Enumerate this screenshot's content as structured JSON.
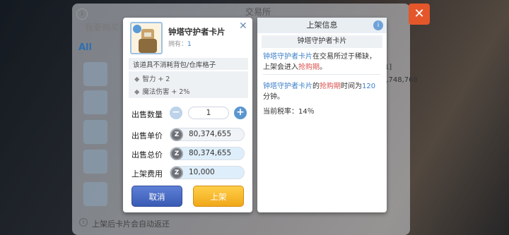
{
  "background": {
    "title": "交易所",
    "search_hint": "我要购买",
    "tab_all": "All",
    "number_visible": "1,748,768",
    "number_top": "[1]",
    "footer_text": "上架后卡片会自动返还",
    "close_label": "✕"
  },
  "left_panel": {
    "card_name": "钟塔守护者卡片",
    "owned_label": "拥有：",
    "owned_value": "1",
    "close_icon": "✕",
    "description": "该道具不消耗背包/仓库格子",
    "stats": [
      "智力 + 2",
      "魔法伤害 + 2%"
    ],
    "sell_qty_label": "出售数量",
    "sell_qty_value": "1",
    "unit_price_label": "出售单价",
    "unit_price_value": "80,374,655",
    "total_price_label": "出售总价",
    "total_price_value": "80,374,655",
    "listing_fee_label": "上架费用",
    "listing_fee_value": "10,000",
    "cancel_label": "取消",
    "confirm_label": "上架",
    "minus": "−",
    "plus": "+",
    "coin_symbol": "Z"
  },
  "right_panel": {
    "title": "上架信息",
    "info_icon": "i",
    "card_name": "钟塔守护者卡片",
    "line1_name": "钟塔守护者卡片",
    "line1_rest": "在交易所过于稀缺，上架会进入",
    "line1_highlight": "抢购期",
    "line1_end": "。",
    "line2_name": "钟塔守护者卡片",
    "line2_mid": "的",
    "line2_highlight": "抢购期",
    "line2_rest": "时间为",
    "line2_minutes": "120",
    "line2_end": "分钟。",
    "tax_label": "当前税率：",
    "tax_value": "14％"
  }
}
